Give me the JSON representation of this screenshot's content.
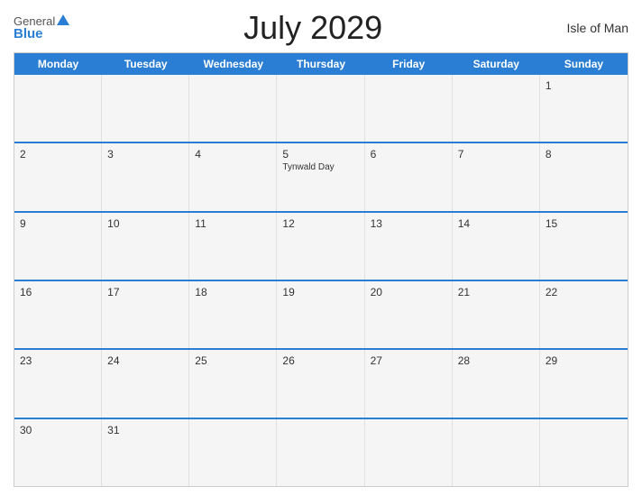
{
  "header": {
    "logo_general": "General",
    "logo_blue": "Blue",
    "title": "July 2029",
    "region": "Isle of Man"
  },
  "calendar": {
    "days_of_week": [
      "Monday",
      "Tuesday",
      "Wednesday",
      "Thursday",
      "Friday",
      "Saturday",
      "Sunday"
    ],
    "weeks": [
      [
        {
          "day": "",
          "event": ""
        },
        {
          "day": "",
          "event": ""
        },
        {
          "day": "",
          "event": ""
        },
        {
          "day": "",
          "event": ""
        },
        {
          "day": "",
          "event": ""
        },
        {
          "day": "",
          "event": ""
        },
        {
          "day": "1",
          "event": ""
        }
      ],
      [
        {
          "day": "2",
          "event": ""
        },
        {
          "day": "3",
          "event": ""
        },
        {
          "day": "4",
          "event": ""
        },
        {
          "day": "5",
          "event": "Tynwald Day"
        },
        {
          "day": "6",
          "event": ""
        },
        {
          "day": "7",
          "event": ""
        },
        {
          "day": "8",
          "event": ""
        }
      ],
      [
        {
          "day": "9",
          "event": ""
        },
        {
          "day": "10",
          "event": ""
        },
        {
          "day": "11",
          "event": ""
        },
        {
          "day": "12",
          "event": ""
        },
        {
          "day": "13",
          "event": ""
        },
        {
          "day": "14",
          "event": ""
        },
        {
          "day": "15",
          "event": ""
        }
      ],
      [
        {
          "day": "16",
          "event": ""
        },
        {
          "day": "17",
          "event": ""
        },
        {
          "day": "18",
          "event": ""
        },
        {
          "day": "19",
          "event": ""
        },
        {
          "day": "20",
          "event": ""
        },
        {
          "day": "21",
          "event": ""
        },
        {
          "day": "22",
          "event": ""
        }
      ],
      [
        {
          "day": "23",
          "event": ""
        },
        {
          "day": "24",
          "event": ""
        },
        {
          "day": "25",
          "event": ""
        },
        {
          "day": "26",
          "event": ""
        },
        {
          "day": "27",
          "event": ""
        },
        {
          "day": "28",
          "event": ""
        },
        {
          "day": "29",
          "event": ""
        }
      ],
      [
        {
          "day": "30",
          "event": ""
        },
        {
          "day": "31",
          "event": ""
        },
        {
          "day": "",
          "event": ""
        },
        {
          "day": "",
          "event": ""
        },
        {
          "day": "",
          "event": ""
        },
        {
          "day": "",
          "event": ""
        },
        {
          "day": "",
          "event": ""
        }
      ]
    ]
  }
}
